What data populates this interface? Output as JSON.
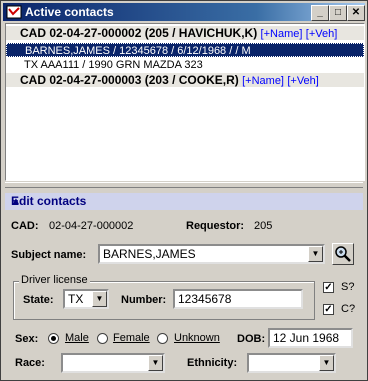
{
  "window": {
    "title": "Active contacts",
    "minimize_label": "_",
    "maximize_label": "□",
    "close_label": "✕"
  },
  "contacts": {
    "group1": {
      "title": "CAD 02-04-27-000002 (205 / HAVICHUK,K)",
      "add_name": "[+Name]",
      "add_veh": "[+Veh]"
    },
    "selected_row": "BARNES,JAMES / 12345678 / 6/12/1968 / / M",
    "vehicle_row": "TX AAA111 / 1990 GRN MAZDA 323",
    "group2": {
      "title": "CAD 02-04-27-000003 (203 / COOKE,R)",
      "add_name": "[+Name]",
      "add_veh": "[+Veh]"
    }
  },
  "edit": {
    "header": "Edit contacts",
    "cad_label": "CAD:",
    "cad_value": "02-04-27-000002",
    "requestor_label": "Requestor:",
    "requestor_value": "205",
    "subject_label": "Subject name:",
    "subject_value": "BARNES,JAMES",
    "driver_license_label": "Driver license",
    "state_label": "State:",
    "state_value": "TX",
    "number_label": "Number:",
    "number_value": "12345678",
    "s_label": "S?",
    "c_label": "C?",
    "sex_label": "Sex:",
    "male_label": "Male",
    "female_label": "Female",
    "unknown_label": "Unknown",
    "dob_label": "DOB:",
    "dob_value": "12 Jun 1968",
    "race_label": "Race:",
    "race_value": "",
    "ethnicity_label": "Ethnicity:",
    "ethnicity_value": ""
  },
  "colors": {
    "title_start": "#0a246a",
    "selection": "#0a246a",
    "link": "#0000ff",
    "panel_header": "#cfd3ec"
  }
}
